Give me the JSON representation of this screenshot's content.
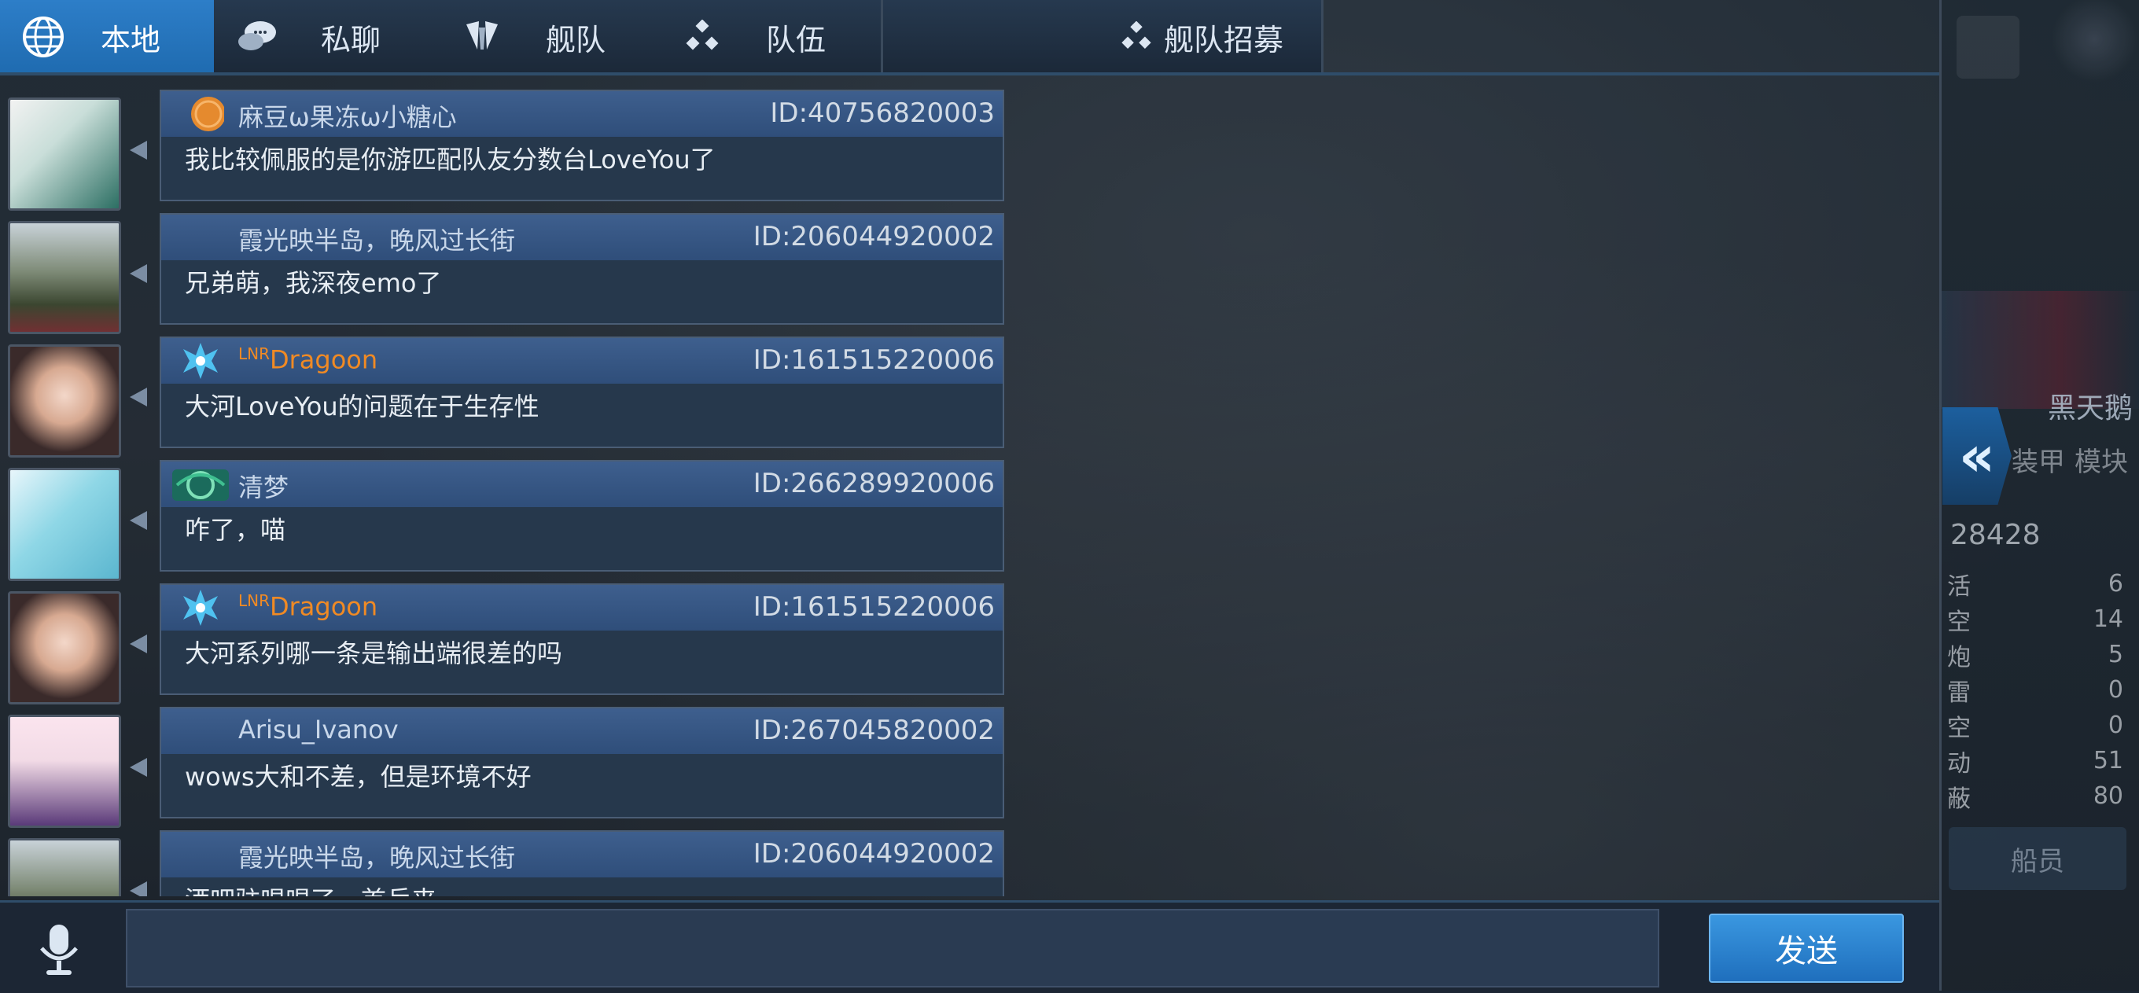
{
  "tabs": [
    {
      "label": "本地",
      "icon": "globe-icon",
      "active": true
    },
    {
      "label": "私聊",
      "icon": "chat-bubbles-icon",
      "active": false
    },
    {
      "label": "舰队",
      "icon": "fleet-shield-icon",
      "active": false
    },
    {
      "label": "队伍",
      "icon": "team-dots-icon",
      "active": false
    }
  ],
  "fleet_recruit": {
    "label": "舰队招募",
    "icon": "team-dots-icon"
  },
  "messages": [
    {
      "name": "麻豆ω果冻ω小糖心",
      "id": "ID:40756820003",
      "text": "我比较佩服的是你游匹配队友分数台LoveYou了",
      "name_color": "#c8d7ea",
      "badge": "orange-coin-badge"
    },
    {
      "name": "霞光映半岛，晚风过长街",
      "id": "ID:206044920002",
      "text": "兄弟萌，我深夜emo了",
      "name_color": "#c8d7ea",
      "badge": ""
    },
    {
      "name_prefix": "LNR",
      "name": "Dragoon",
      "id": "ID:161515220006",
      "text": "大河LoveYou的问题在于生存性",
      "name_color": "#f08a24",
      "badge": "blue-snowflake-badge"
    },
    {
      "name": "清梦",
      "id": "ID:266289920006",
      "text": "咋了，喵",
      "name_color": "#c8d7ea",
      "badge": "green-emblem-badge"
    },
    {
      "name_prefix": "LNR",
      "name": "Dragoon",
      "id": "ID:161515220006",
      "text": "大河系列哪一条是输出端很差的吗",
      "name_color": "#f08a24",
      "badge": "blue-snowflake-badge"
    },
    {
      "name": "Arisu_Ivanov",
      "id": "ID:267045820002",
      "text": "wows大和不差，但是环境不好",
      "name_color": "#c8d7ea",
      "badge": ""
    },
    {
      "name": "霞光映半岛，晚风过长街",
      "id": "ID:206044920002",
      "text": "洒吧驻唱唱了一首兵来",
      "name_color": "#c8d7ea",
      "badge": ""
    }
  ],
  "input": {
    "placeholder": "",
    "value": ""
  },
  "send_label": "发送",
  "side_panel": {
    "ship_name": "黑天鹅",
    "tab_armor": "装甲",
    "tab_module": "模块",
    "big_number": "28428",
    "stats": [
      {
        "label": "活",
        "value": "6"
      },
      {
        "label": "空",
        "value": "14"
      },
      {
        "label": "炮",
        "value": "5"
      },
      {
        "label": "雷",
        "value": "0"
      },
      {
        "label": "空",
        "value": "0"
      },
      {
        "label": "动",
        "value": "51"
      },
      {
        "label": "蔽",
        "value": "80"
      }
    ],
    "crew_label": "船员"
  },
  "colors": {
    "accent": "#2d7ec8",
    "header": "#3e5f8e",
    "bubble": "#26384c",
    "orange_name": "#f08a24"
  }
}
